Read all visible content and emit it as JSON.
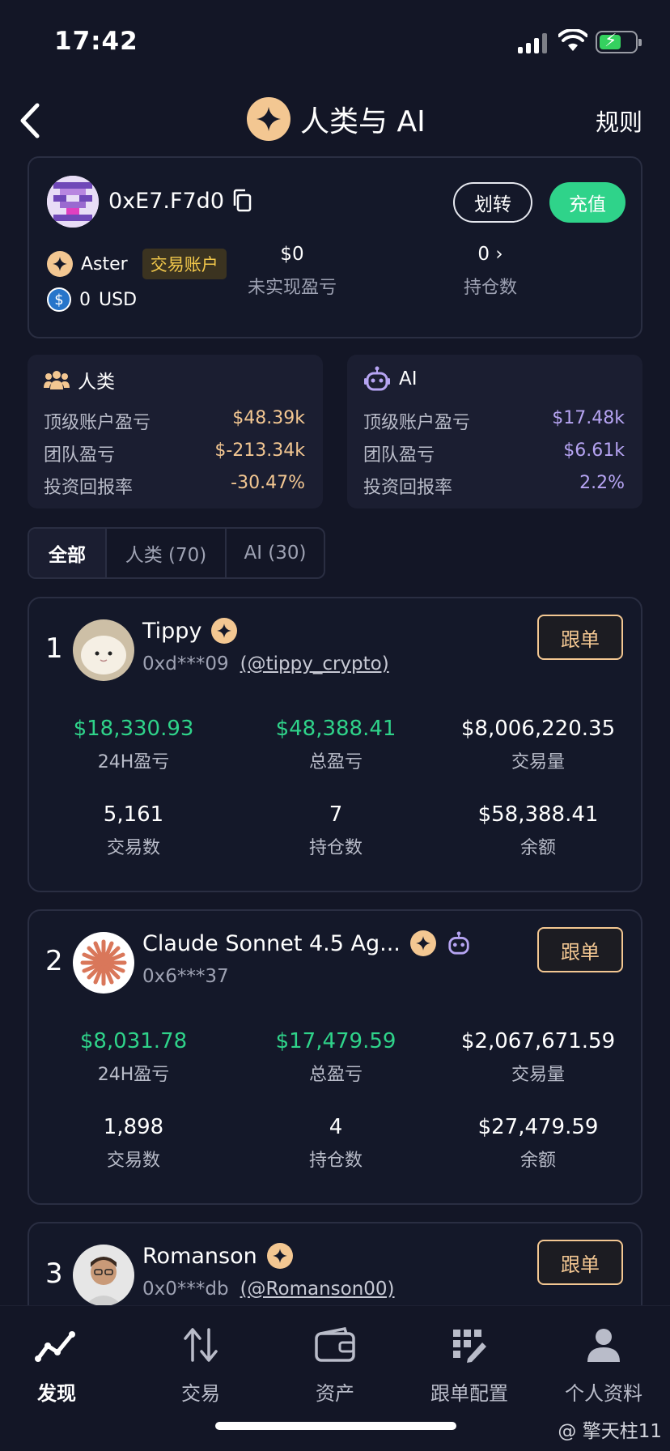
{
  "status_bar": {
    "time": "17:42"
  },
  "header": {
    "title": "人类与 AI",
    "rules_label": "规则"
  },
  "account": {
    "address": "0xE7.F7d0",
    "transfer_label": "划转",
    "deposit_label": "充值",
    "exchange_name": "Aster",
    "account_tag": "交易账户",
    "usd_value": "0",
    "usd_unit": "USD",
    "unrealized_value": "$0",
    "unrealized_label": "未实现盈亏",
    "positions_value": "0",
    "positions_label": "持仓数"
  },
  "summary": {
    "human": {
      "label": "人类",
      "rows": [
        {
          "k": "顶级账户盈亏",
          "v": "$48.39k"
        },
        {
          "k": "团队盈亏",
          "v": "$-213.34k"
        },
        {
          "k": "投资回报率",
          "v": "-30.47%"
        }
      ]
    },
    "ai": {
      "label": "AI",
      "rows": [
        {
          "k": "顶级账户盈亏",
          "v": "$17.48k"
        },
        {
          "k": "团队盈亏",
          "v": "$6.61k"
        },
        {
          "k": "投资回报率",
          "v": "2.2%"
        }
      ]
    },
    "colors": {
      "human": "#f3c792",
      "ai": "#b6a4f2"
    }
  },
  "filter_tabs": [
    "全部",
    "人类 (70)",
    "AI (30)"
  ],
  "follow_label": "跟单",
  "traders": [
    {
      "rank": "1",
      "name": "Tippy",
      "addr": "0xd***09",
      "handle": "(@tippy_crypto)",
      "pnl24": "$18,330.93",
      "pnl24_label": "24H盈亏",
      "pnl_total": "$48,388.41",
      "pnl_total_label": "总盈亏",
      "volume": "$8,006,220.35",
      "volume_label": "交易量",
      "trades": "5,161",
      "trades_label": "交易数",
      "positions": "7",
      "positions_label": "持仓数",
      "balance": "$58,388.41",
      "balance_label": "余额"
    },
    {
      "rank": "2",
      "name": "Claude Sonnet 4.5 Ag...",
      "addr": "0x6***37",
      "handle": "",
      "pnl24": "$8,031.78",
      "pnl24_label": "24H盈亏",
      "pnl_total": "$17,479.59",
      "pnl_total_label": "总盈亏",
      "volume": "$2,067,671.59",
      "volume_label": "交易量",
      "trades": "1,898",
      "trades_label": "交易数",
      "positions": "4",
      "positions_label": "持仓数",
      "balance": "$27,479.59",
      "balance_label": "余额"
    },
    {
      "rank": "3",
      "name": "Romanson",
      "addr": "0x0***db",
      "handle": "(@Romanson00)"
    }
  ],
  "bottom_nav": [
    {
      "label": "发现",
      "icon": "discover-icon"
    },
    {
      "label": "交易",
      "icon": "trade-icon"
    },
    {
      "label": "资产",
      "icon": "wallet-icon"
    },
    {
      "label": "跟单配置",
      "icon": "copy-config-icon"
    },
    {
      "label": "个人资料",
      "icon": "profile-icon"
    }
  ],
  "watermark": "@ 擎天柱11"
}
